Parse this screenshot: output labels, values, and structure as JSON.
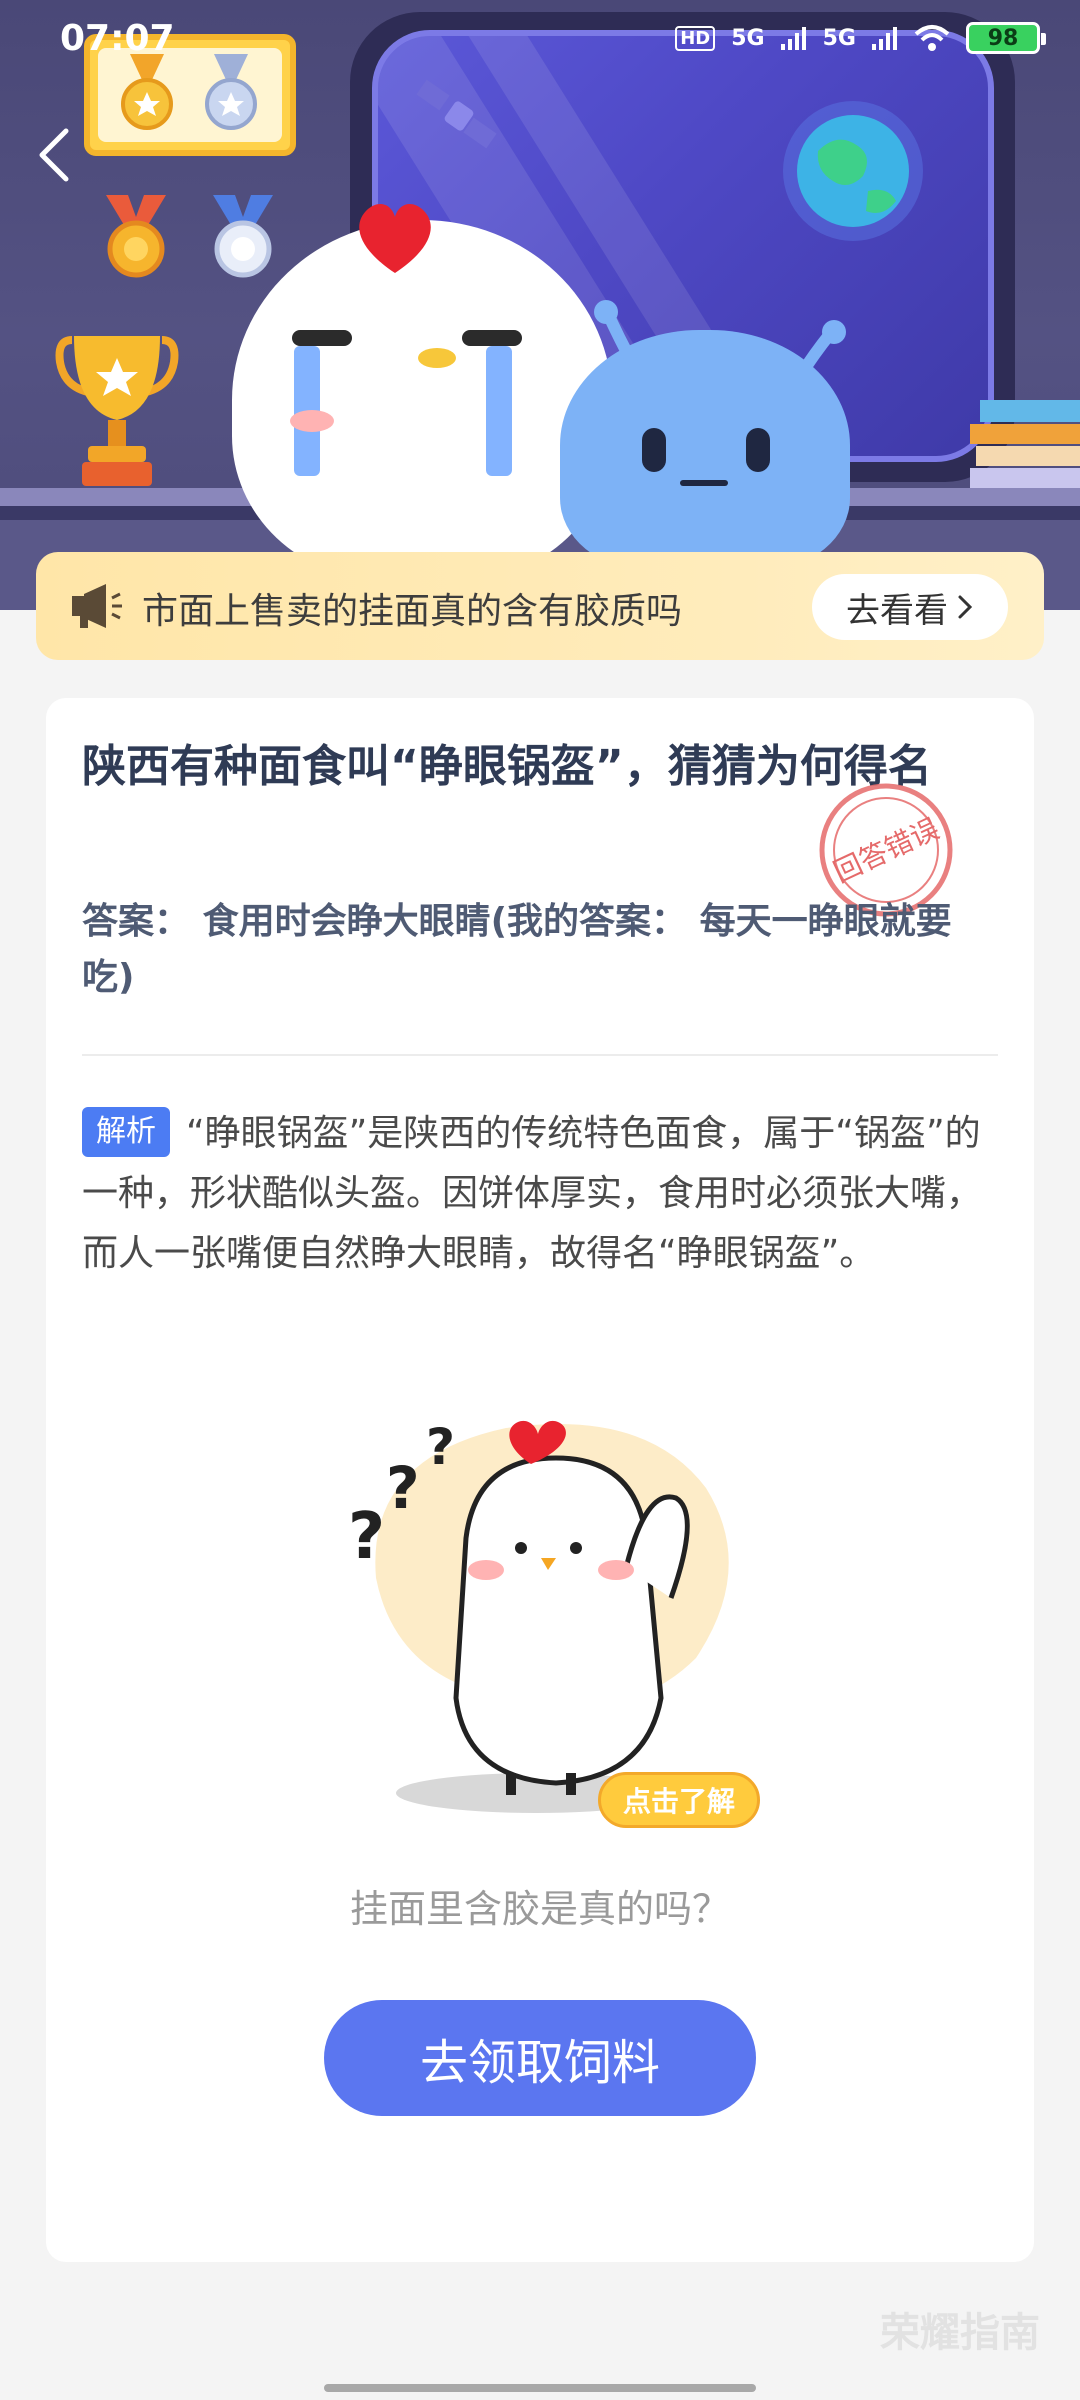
{
  "status_bar": {
    "time": "07:07",
    "network_1": "5G",
    "network_2": "5G",
    "hd_label": "HD",
    "battery": "98"
  },
  "banner": {
    "text": "市面上售卖的挂面真的含有胶质吗",
    "button_label": "去看看"
  },
  "question": {
    "title": "陕西有种面食叫“睁眼锅盔”，猜猜为何得名",
    "answer_label": "答案：",
    "answer": "食用时会睁大眼睛",
    "my_answer_label": "(我的答案：",
    "my_answer": "每天一睁眼就要吃)",
    "stamp_text": "回答错误"
  },
  "analysis": {
    "tag": "解析",
    "text": "“睁眼锅盔”是陕西的传统特色面食，属于“锅盔”的一种，形状酷似头盔。因饼体厚实，食用时必须张大嘴，而人一张嘴便自然睁大眼睛，故得名“睁眼锅盔”。"
  },
  "illustration": {
    "click_label": "点击了解"
  },
  "hint": "挂面里含胶是真的吗？",
  "cta_label": "去领取饲料",
  "watermark": "荣耀指南",
  "colors": {
    "accent": "#5b76f0",
    "tag": "#4c7cf3",
    "stamp": "#e56a6a",
    "banner": "#ffe6a8"
  }
}
